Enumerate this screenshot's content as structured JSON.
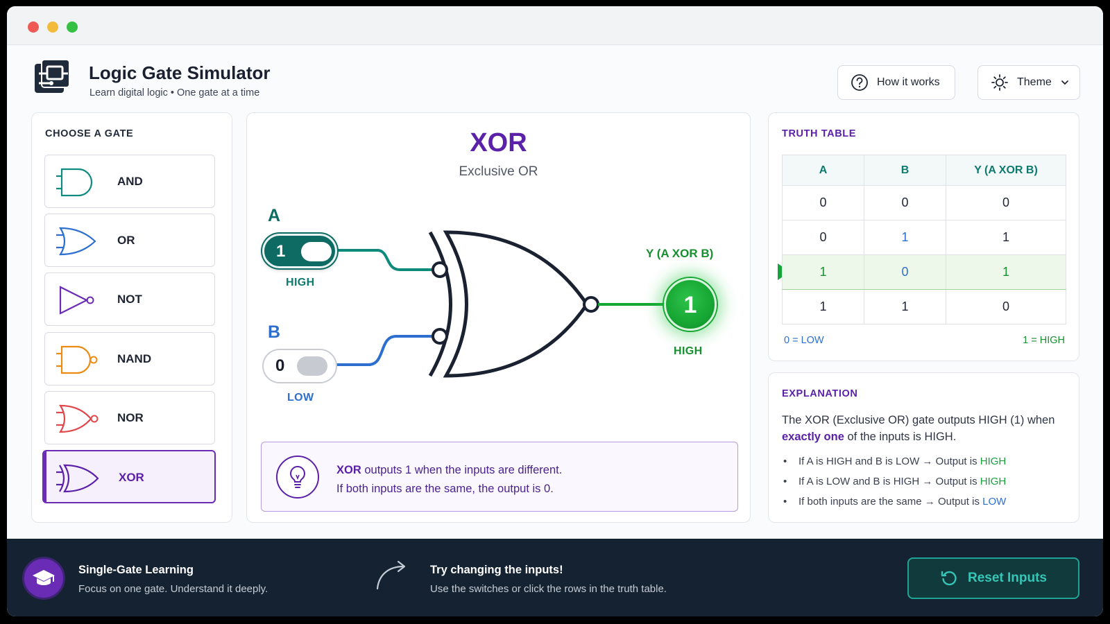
{
  "header": {
    "title": "Logic Gate Simulator",
    "subtitle": "Learn digital logic • One gate at a time",
    "how_it_works": "How it works",
    "theme": "Theme"
  },
  "gates_panel": {
    "title": "CHOOSE A GATE",
    "items": [
      {
        "label": "AND",
        "color": "#0f8a7e",
        "icon": "and-gate-icon"
      },
      {
        "label": "OR",
        "color": "#2d6fcf",
        "icon": "or-gate-icon"
      },
      {
        "label": "NOT",
        "color": "#6a2bb5",
        "icon": "not-gate-icon"
      },
      {
        "label": "NAND",
        "color": "#ec8a12",
        "icon": "nand-gate-icon"
      },
      {
        "label": "NOR",
        "color": "#e0474c",
        "icon": "nor-gate-icon"
      },
      {
        "label": "XOR",
        "color": "#5b21a8",
        "icon": "xor-gate-icon",
        "selected": true
      }
    ]
  },
  "diagram": {
    "gate_name": "XOR",
    "gate_full": "Exclusive OR",
    "input_a": {
      "label": "A",
      "value": "1",
      "state": "HIGH",
      "color": "#0d6b63"
    },
    "input_b": {
      "label": "B",
      "value": "0",
      "state": "LOW",
      "color": "#2d6fcf"
    },
    "output": {
      "label": "Y (A XOR B)",
      "value": "1",
      "state": "HIGH",
      "color": "#16a633"
    },
    "hint_bold": "XOR",
    "hint_line1": " outputs 1 when the inputs are different.",
    "hint_line2": "If both inputs are the same, the output is 0."
  },
  "truth_table": {
    "title": "TRUTH TABLE",
    "headers": [
      "A",
      "B",
      "Y (A XOR B)"
    ],
    "rows": [
      [
        "0",
        "0",
        "0"
      ],
      [
        "0",
        "1",
        "1"
      ],
      [
        "1",
        "0",
        "1"
      ],
      [
        "1",
        "1",
        "0"
      ]
    ],
    "selected_row": 2,
    "legend_low": "0 = LOW",
    "legend_high": "1 = HIGH"
  },
  "explanation": {
    "title": "EXPLANATION",
    "text_pre": "The XOR (Exclusive OR) gate outputs HIGH (1) when ",
    "text_bold": "exactly one",
    "text_post": " of the inputs is HIGH.",
    "bullets": [
      {
        "text": "If A is HIGH and B is LOW  →  Output is ",
        "result": "HIGH"
      },
      {
        "text": "If A is LOW and B is HIGH  →  Output is ",
        "result": "HIGH"
      },
      {
        "text": "If both inputs are the same  →  Output is ",
        "result": "LOW"
      }
    ]
  },
  "footer": {
    "title": "Single-Gate Learning",
    "subtitle": "Focus on one gate. Understand it deeply.",
    "try_title": "Try changing the inputs!",
    "try_subtitle": "Use the switches or click the rows in the truth table.",
    "reset": "Reset Inputs"
  }
}
